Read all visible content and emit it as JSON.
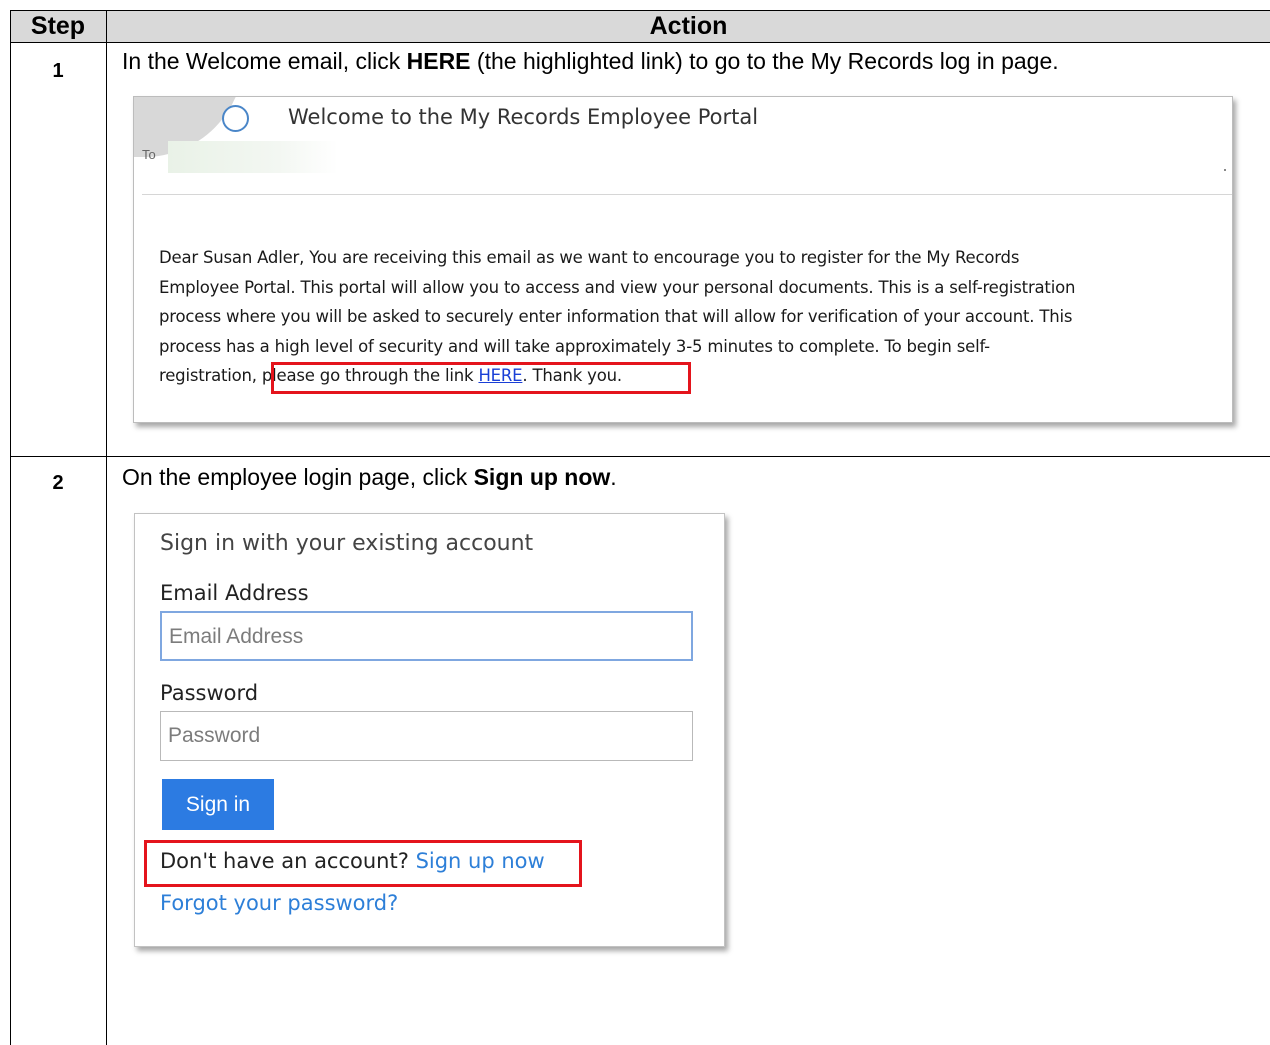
{
  "header": {
    "step": "Step",
    "action": "Action"
  },
  "steps": [
    {
      "number": "1",
      "text_before": "In the Welcome email, click ",
      "text_bold": "HERE",
      "text_after": " (the highlighted link) to go to the My Records log in page.",
      "email": {
        "subject": "Welcome to the My Records Employee Portal",
        "to_label": "To",
        "body_lines": [
          "Dear Susan Adler, You are receiving this email as we want to encourage you to register for the My Records",
          "Employee Portal. This portal will allow you to access and view your personal documents. This is a self-registration",
          "process where you will be asked to securely enter information that will allow for verification of your account. This",
          "process has a high level of security and will take approximately 3-5 minutes to complete. To begin self-"
        ],
        "last_line_prefix": "registration, please go through the link ",
        "link_text": "HERE",
        "last_line_suffix": ". Thank you."
      }
    },
    {
      "number": "2",
      "text_before": "On the employee login page, click ",
      "text_bold": "Sign up now",
      "text_after": ".",
      "login": {
        "title": "Sign in with your existing account",
        "email_label": "Email Address",
        "email_placeholder": "Email Address",
        "password_label": "Password",
        "password_placeholder": "Password",
        "signin_label": "Sign in",
        "no_account_text": "Don't have an account? ",
        "signup_link": "Sign up now",
        "forgot_link": "Forgot your password?"
      }
    }
  ],
  "colors": {
    "header_bg": "#d9d9d9",
    "highlight": "#e4141c",
    "link": "#2d7fd8",
    "button": "#2c7be2"
  }
}
